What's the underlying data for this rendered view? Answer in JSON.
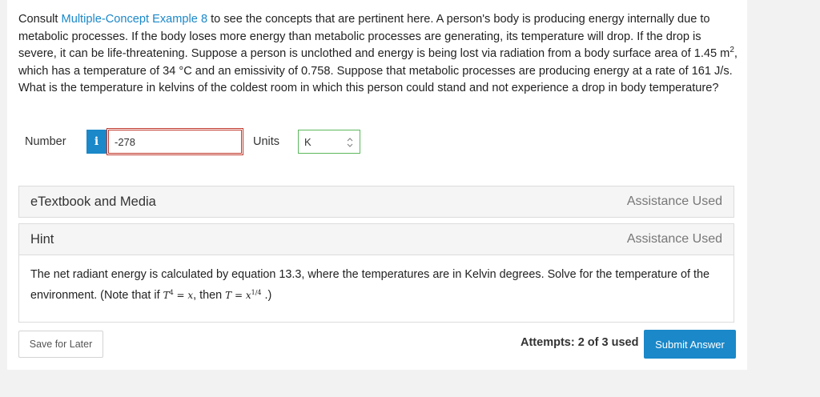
{
  "question": {
    "prefix": "Consult ",
    "link_text": "Multiple-Concept Example 8",
    "part1": " to see the concepts that are pertinent here. A person's body is producing energy internally due to metabolic processes. If the body loses more energy than metabolic processes are generating, its temperature will drop. If the drop is severe, it can be life-threatening. Suppose a person is unclothed and energy is being lost via radiation from a body surface area of 1.45 m",
    "area_exp": "2",
    "part2": ", which has a temperature of 34 °C and an emissivity of 0.758. Suppose that metabolic processes are producing energy at a rate of 161 J/s. What is the temperature in kelvins of the coldest room in which this person could stand and not experience a drop in body temperature?"
  },
  "answer": {
    "number_label": "Number",
    "info_icon": "i",
    "number_value": "-278",
    "units_label": "Units",
    "units_value": "K"
  },
  "etextbook": {
    "title": "eTextbook and Media",
    "status": "Assistance Used"
  },
  "hint": {
    "title": "Hint",
    "status": "Assistance Used",
    "text1": "The net radiant energy is calculated by equation 13.3, where the temperatures are in Kelvin degrees. Solve for the temperature of the environment. (Note that if ",
    "eq1_var": "T",
    "eq1_exp": "4",
    "eq1_rest": " = x",
    "sep": ", then ",
    "eq2_var": "T",
    "eq2_mid": " = x",
    "eq2_exp": "1/4",
    "text2": " .)"
  },
  "footer": {
    "save_label": "Save for Later",
    "attempts": "Attempts: 2 of 3 used",
    "submit_label": "Submit Answer"
  },
  "colors": {
    "accent": "#1a88c9",
    "error_border": "#c0392b",
    "valid_border": "#5cb85c"
  }
}
